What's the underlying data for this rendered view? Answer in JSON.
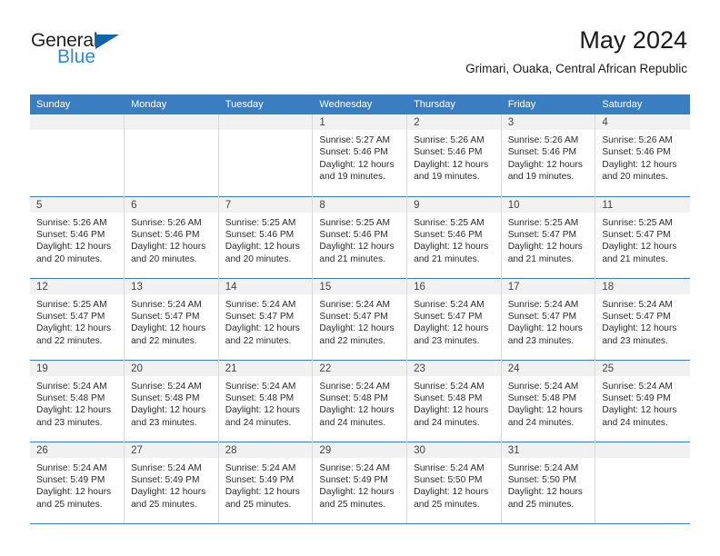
{
  "brand": {
    "name_part1": "General",
    "name_part2": "Blue",
    "triangle_icon": "triangle-icon",
    "accent_color": "#1264a9",
    "secondary_color": "#2e8bd4"
  },
  "header": {
    "title": "May 2024",
    "subtitle": "Grimari, Ouaka, Central African Republic"
  },
  "theme": {
    "header_row_bg": "#3a7dc0",
    "daynum_band_bg": "#f1f1f1",
    "grid_line": "#d8d8d8"
  },
  "weekdays": [
    {
      "label": "Sunday"
    },
    {
      "label": "Monday"
    },
    {
      "label": "Tuesday"
    },
    {
      "label": "Wednesday"
    },
    {
      "label": "Thursday"
    },
    {
      "label": "Friday"
    },
    {
      "label": "Saturday"
    }
  ],
  "weeks": [
    [
      {
        "day": "",
        "empty": true,
        "sunrise": "",
        "sunset": "",
        "daylight_line1": "",
        "daylight_line2": ""
      },
      {
        "day": "",
        "empty": true,
        "sunrise": "",
        "sunset": "",
        "daylight_line1": "",
        "daylight_line2": ""
      },
      {
        "day": "",
        "empty": true,
        "sunrise": "",
        "sunset": "",
        "daylight_line1": "",
        "daylight_line2": ""
      },
      {
        "day": "1",
        "empty": false,
        "sunrise": "Sunrise: 5:27 AM",
        "sunset": "Sunset: 5:46 PM",
        "daylight_line1": "Daylight: 12 hours",
        "daylight_line2": "and 19 minutes."
      },
      {
        "day": "2",
        "empty": false,
        "sunrise": "Sunrise: 5:26 AM",
        "sunset": "Sunset: 5:46 PM",
        "daylight_line1": "Daylight: 12 hours",
        "daylight_line2": "and 19 minutes."
      },
      {
        "day": "3",
        "empty": false,
        "sunrise": "Sunrise: 5:26 AM",
        "sunset": "Sunset: 5:46 PM",
        "daylight_line1": "Daylight: 12 hours",
        "daylight_line2": "and 19 minutes."
      },
      {
        "day": "4",
        "empty": false,
        "sunrise": "Sunrise: 5:26 AM",
        "sunset": "Sunset: 5:46 PM",
        "daylight_line1": "Daylight: 12 hours",
        "daylight_line2": "and 20 minutes."
      }
    ],
    [
      {
        "day": "5",
        "empty": false,
        "sunrise": "Sunrise: 5:26 AM",
        "sunset": "Sunset: 5:46 PM",
        "daylight_line1": "Daylight: 12 hours",
        "daylight_line2": "and 20 minutes."
      },
      {
        "day": "6",
        "empty": false,
        "sunrise": "Sunrise: 5:26 AM",
        "sunset": "Sunset: 5:46 PM",
        "daylight_line1": "Daylight: 12 hours",
        "daylight_line2": "and 20 minutes."
      },
      {
        "day": "7",
        "empty": false,
        "sunrise": "Sunrise: 5:25 AM",
        "sunset": "Sunset: 5:46 PM",
        "daylight_line1": "Daylight: 12 hours",
        "daylight_line2": "and 20 minutes."
      },
      {
        "day": "8",
        "empty": false,
        "sunrise": "Sunrise: 5:25 AM",
        "sunset": "Sunset: 5:46 PM",
        "daylight_line1": "Daylight: 12 hours",
        "daylight_line2": "and 21 minutes."
      },
      {
        "day": "9",
        "empty": false,
        "sunrise": "Sunrise: 5:25 AM",
        "sunset": "Sunset: 5:46 PM",
        "daylight_line1": "Daylight: 12 hours",
        "daylight_line2": "and 21 minutes."
      },
      {
        "day": "10",
        "empty": false,
        "sunrise": "Sunrise: 5:25 AM",
        "sunset": "Sunset: 5:47 PM",
        "daylight_line1": "Daylight: 12 hours",
        "daylight_line2": "and 21 minutes."
      },
      {
        "day": "11",
        "empty": false,
        "sunrise": "Sunrise: 5:25 AM",
        "sunset": "Sunset: 5:47 PM",
        "daylight_line1": "Daylight: 12 hours",
        "daylight_line2": "and 21 minutes."
      }
    ],
    [
      {
        "day": "12",
        "empty": false,
        "sunrise": "Sunrise: 5:25 AM",
        "sunset": "Sunset: 5:47 PM",
        "daylight_line1": "Daylight: 12 hours",
        "daylight_line2": "and 22 minutes."
      },
      {
        "day": "13",
        "empty": false,
        "sunrise": "Sunrise: 5:24 AM",
        "sunset": "Sunset: 5:47 PM",
        "daylight_line1": "Daylight: 12 hours",
        "daylight_line2": "and 22 minutes."
      },
      {
        "day": "14",
        "empty": false,
        "sunrise": "Sunrise: 5:24 AM",
        "sunset": "Sunset: 5:47 PM",
        "daylight_line1": "Daylight: 12 hours",
        "daylight_line2": "and 22 minutes."
      },
      {
        "day": "15",
        "empty": false,
        "sunrise": "Sunrise: 5:24 AM",
        "sunset": "Sunset: 5:47 PM",
        "daylight_line1": "Daylight: 12 hours",
        "daylight_line2": "and 22 minutes."
      },
      {
        "day": "16",
        "empty": false,
        "sunrise": "Sunrise: 5:24 AM",
        "sunset": "Sunset: 5:47 PM",
        "daylight_line1": "Daylight: 12 hours",
        "daylight_line2": "and 23 minutes."
      },
      {
        "day": "17",
        "empty": false,
        "sunrise": "Sunrise: 5:24 AM",
        "sunset": "Sunset: 5:47 PM",
        "daylight_line1": "Daylight: 12 hours",
        "daylight_line2": "and 23 minutes."
      },
      {
        "day": "18",
        "empty": false,
        "sunrise": "Sunrise: 5:24 AM",
        "sunset": "Sunset: 5:47 PM",
        "daylight_line1": "Daylight: 12 hours",
        "daylight_line2": "and 23 minutes."
      }
    ],
    [
      {
        "day": "19",
        "empty": false,
        "sunrise": "Sunrise: 5:24 AM",
        "sunset": "Sunset: 5:48 PM",
        "daylight_line1": "Daylight: 12 hours",
        "daylight_line2": "and 23 minutes."
      },
      {
        "day": "20",
        "empty": false,
        "sunrise": "Sunrise: 5:24 AM",
        "sunset": "Sunset: 5:48 PM",
        "daylight_line1": "Daylight: 12 hours",
        "daylight_line2": "and 23 minutes."
      },
      {
        "day": "21",
        "empty": false,
        "sunrise": "Sunrise: 5:24 AM",
        "sunset": "Sunset: 5:48 PM",
        "daylight_line1": "Daylight: 12 hours",
        "daylight_line2": "and 24 minutes."
      },
      {
        "day": "22",
        "empty": false,
        "sunrise": "Sunrise: 5:24 AM",
        "sunset": "Sunset: 5:48 PM",
        "daylight_line1": "Daylight: 12 hours",
        "daylight_line2": "and 24 minutes."
      },
      {
        "day": "23",
        "empty": false,
        "sunrise": "Sunrise: 5:24 AM",
        "sunset": "Sunset: 5:48 PM",
        "daylight_line1": "Daylight: 12 hours",
        "daylight_line2": "and 24 minutes."
      },
      {
        "day": "24",
        "empty": false,
        "sunrise": "Sunrise: 5:24 AM",
        "sunset": "Sunset: 5:48 PM",
        "daylight_line1": "Daylight: 12 hours",
        "daylight_line2": "and 24 minutes."
      },
      {
        "day": "25",
        "empty": false,
        "sunrise": "Sunrise: 5:24 AM",
        "sunset": "Sunset: 5:49 PM",
        "daylight_line1": "Daylight: 12 hours",
        "daylight_line2": "and 24 minutes."
      }
    ],
    [
      {
        "day": "26",
        "empty": false,
        "sunrise": "Sunrise: 5:24 AM",
        "sunset": "Sunset: 5:49 PM",
        "daylight_line1": "Daylight: 12 hours",
        "daylight_line2": "and 25 minutes."
      },
      {
        "day": "27",
        "empty": false,
        "sunrise": "Sunrise: 5:24 AM",
        "sunset": "Sunset: 5:49 PM",
        "daylight_line1": "Daylight: 12 hours",
        "daylight_line2": "and 25 minutes."
      },
      {
        "day": "28",
        "empty": false,
        "sunrise": "Sunrise: 5:24 AM",
        "sunset": "Sunset: 5:49 PM",
        "daylight_line1": "Daylight: 12 hours",
        "daylight_line2": "and 25 minutes."
      },
      {
        "day": "29",
        "empty": false,
        "sunrise": "Sunrise: 5:24 AM",
        "sunset": "Sunset: 5:49 PM",
        "daylight_line1": "Daylight: 12 hours",
        "daylight_line2": "and 25 minutes."
      },
      {
        "day": "30",
        "empty": false,
        "sunrise": "Sunrise: 5:24 AM",
        "sunset": "Sunset: 5:50 PM",
        "daylight_line1": "Daylight: 12 hours",
        "daylight_line2": "and 25 minutes."
      },
      {
        "day": "31",
        "empty": false,
        "sunrise": "Sunrise: 5:24 AM",
        "sunset": "Sunset: 5:50 PM",
        "daylight_line1": "Daylight: 12 hours",
        "daylight_line2": "and 25 minutes."
      },
      {
        "day": "",
        "empty": true,
        "sunrise": "",
        "sunset": "",
        "daylight_line1": "",
        "daylight_line2": ""
      }
    ]
  ]
}
